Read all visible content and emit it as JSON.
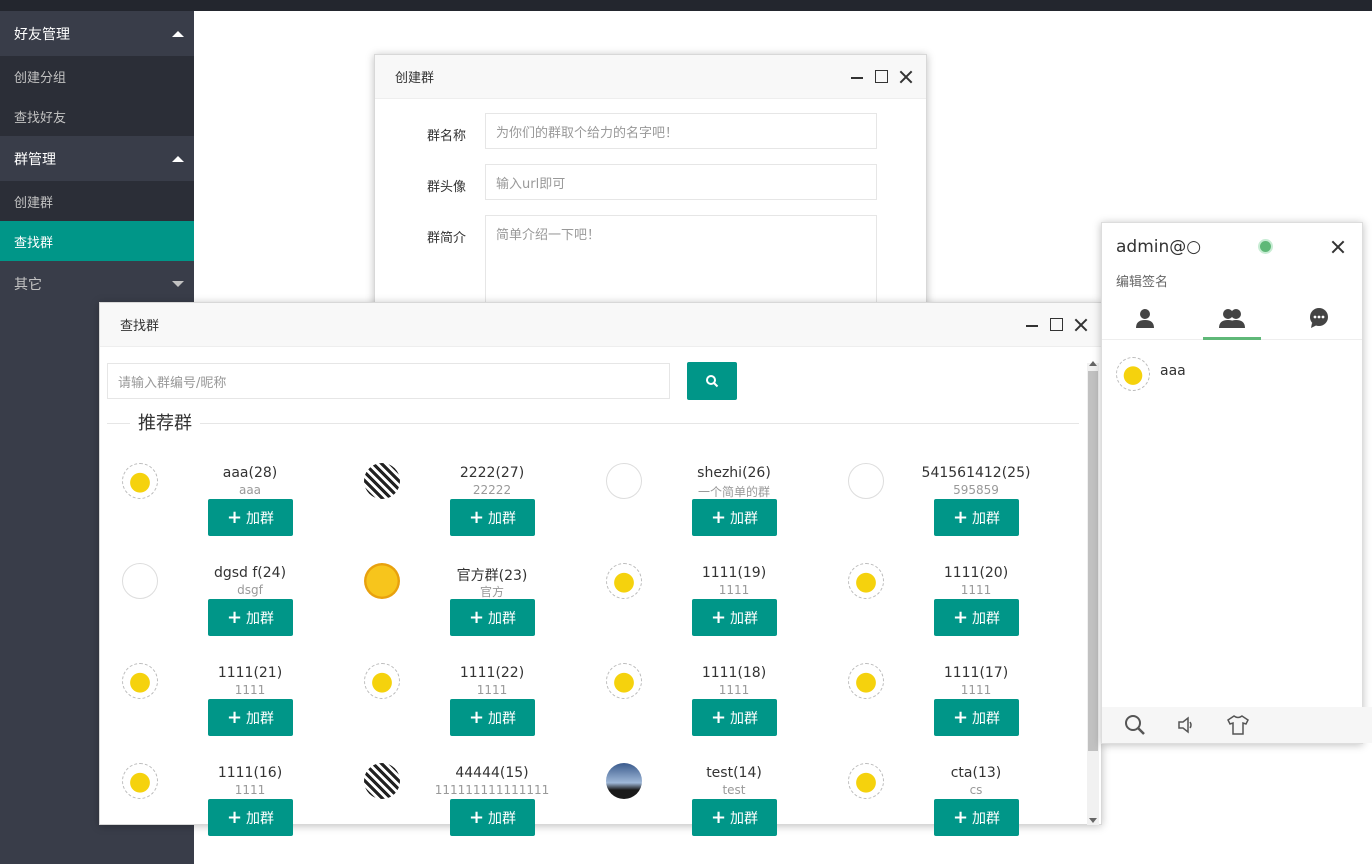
{
  "sidebar": {
    "sections": [
      {
        "label": "好友管理",
        "items": [
          "创建分组",
          "查找好友"
        ]
      },
      {
        "label": "群管理",
        "items": [
          "创建群",
          "查找群"
        ]
      },
      {
        "label": "其它",
        "items": []
      }
    ],
    "active_item": "查找群"
  },
  "create_group": {
    "title": "创建群",
    "fields": [
      {
        "label": "群名称",
        "placeholder": "为你们的群取个给力的名字吧！"
      },
      {
        "label": "群头像",
        "placeholder": "输入url即可"
      },
      {
        "label": "群简介",
        "placeholder": "简单介绍一下吧！"
      }
    ]
  },
  "find_group": {
    "title": "查找群",
    "search_placeholder": "请输入群编号/昵称",
    "section_title": "推荐群",
    "join_label": "加群",
    "groups": [
      {
        "name": "aaa(28)",
        "desc": "aaa",
        "avatar": "sticker"
      },
      {
        "name": "2222(27)",
        "desc": "22222",
        "avatar": "qr"
      },
      {
        "name": "shezhi(26)",
        "desc": "一个简单的群",
        "avatar": "broken"
      },
      {
        "name": "541561412(25)",
        "desc": "595859",
        "avatar": "broken"
      },
      {
        "name": "dgsd f(24)",
        "desc": "dsgf",
        "avatar": "broken"
      },
      {
        "name": "官方群(23)",
        "desc": "官方",
        "avatar": "face"
      },
      {
        "name": "1111(19)",
        "desc": "1111",
        "avatar": "sticker"
      },
      {
        "name": "1111(20)",
        "desc": "1111",
        "avatar": "sticker"
      },
      {
        "name": "1111(21)",
        "desc": "1111",
        "avatar": "sticker"
      },
      {
        "name": "1111(22)",
        "desc": "1111",
        "avatar": "sticker"
      },
      {
        "name": "1111(18)",
        "desc": "1111",
        "avatar": "sticker"
      },
      {
        "name": "1111(17)",
        "desc": "1111",
        "avatar": "sticker"
      },
      {
        "name": "1111(16)",
        "desc": "1111",
        "avatar": "sticker"
      },
      {
        "name": "44444(15)",
        "desc": "111111111111111",
        "avatar": "qr"
      },
      {
        "name": "test(14)",
        "desc": "test",
        "avatar": "sky"
      },
      {
        "name": "cta(13)",
        "desc": "cs",
        "avatar": "sticker"
      }
    ]
  },
  "im_panel": {
    "username": "admin@○",
    "signature": "编辑签名",
    "tabs": [
      "user-icon",
      "group-icon",
      "chat-icon"
    ],
    "active_tab": 1,
    "friend": {
      "name": "aaa"
    },
    "footer_icons": [
      "search-icon",
      "speaker-icon",
      "skin-icon"
    ],
    "status_color": "#5fb878"
  },
  "colors": {
    "accent": "#009688",
    "sidebar_bg": "#393d49",
    "sidebar_sub_bg": "#2b2e37"
  }
}
